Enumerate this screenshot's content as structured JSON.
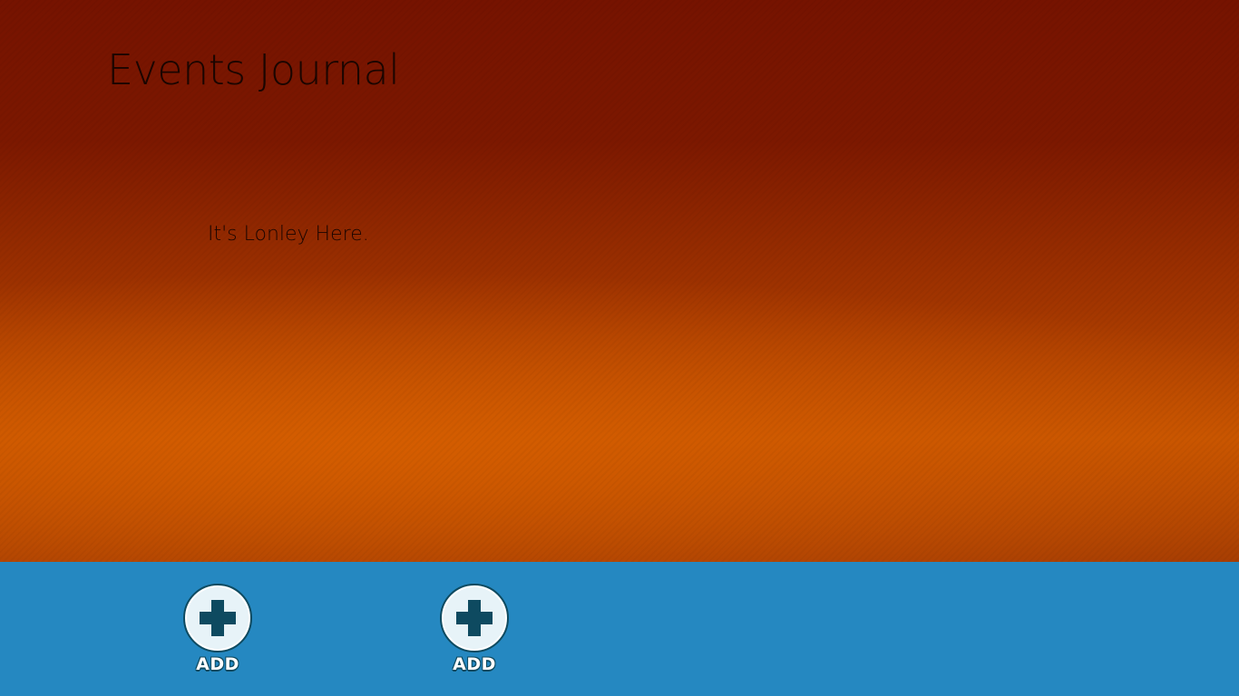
{
  "app": {
    "title": "Events Journal",
    "empty_message": "It's Lonley Here."
  },
  "app_bar": {
    "buttons": [
      {
        "label": "ADD",
        "icon": "plus-icon"
      },
      {
        "label": "ADD",
        "icon": "plus-icon"
      }
    ]
  },
  "colors": {
    "background_top": "#761300",
    "background_glow": "#c75400",
    "app_bar": "#2588c1",
    "icon_fill": "#0e4a60",
    "icon_circle": "#e7f3f8"
  }
}
